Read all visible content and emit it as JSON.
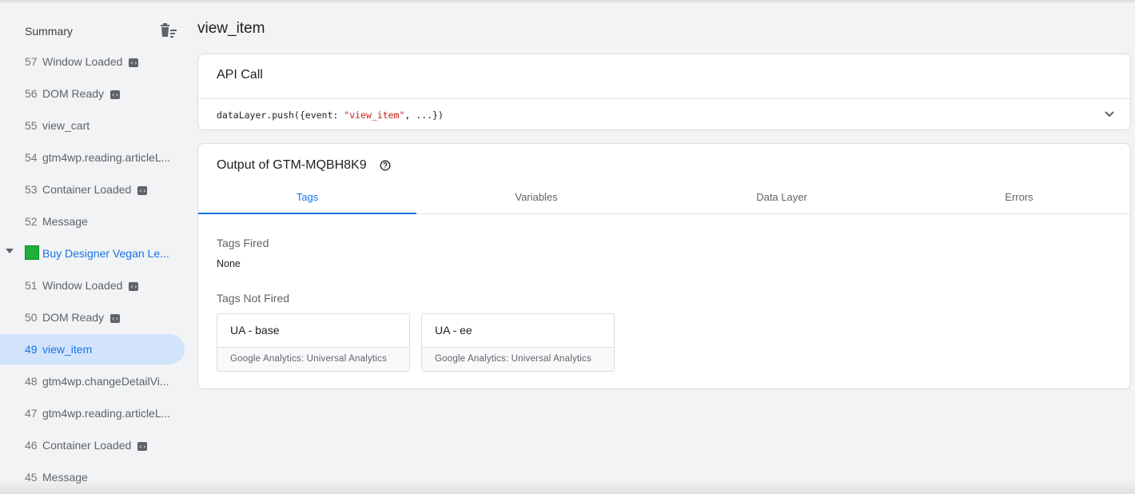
{
  "sidebar": {
    "summary_label": "Summary",
    "events_top": [
      {
        "num": "57",
        "name": "Window Loaded",
        "api": true
      },
      {
        "num": "56",
        "name": "DOM Ready",
        "api": true
      },
      {
        "num": "55",
        "name": "view_cart",
        "api": false
      },
      {
        "num": "54",
        "name": "gtm4wp.reading.articleL...",
        "api": false
      },
      {
        "num": "53",
        "name": "Container Loaded",
        "api": true
      },
      {
        "num": "52",
        "name": "Message",
        "api": false
      }
    ],
    "page_group": {
      "title": "Buy Designer Vegan Le...",
      "swatch_color": "#1db03a",
      "expanded": true
    },
    "events_bottom": [
      {
        "num": "51",
        "name": "Window Loaded",
        "api": true
      },
      {
        "num": "50",
        "name": "DOM Ready",
        "api": true
      },
      {
        "num": "49",
        "name": "view_item",
        "api": false,
        "active": true
      },
      {
        "num": "48",
        "name": "gtm4wp.changeDetailVi...",
        "api": false
      },
      {
        "num": "47",
        "name": "gtm4wp.reading.articleL...",
        "api": false
      },
      {
        "num": "46",
        "name": "Container Loaded",
        "api": true
      },
      {
        "num": "45",
        "name": "Message",
        "api": false
      }
    ]
  },
  "main": {
    "title": "view_item",
    "api_call": {
      "header": "API Call",
      "code_prefix": "dataLayer.push({event: ",
      "code_string": "\"view_item\"",
      "code_suffix": ", ...})"
    },
    "output": {
      "header": "Output of GTM-MQBH8K9",
      "tabs": [
        "Tags",
        "Variables",
        "Data Layer",
        "Errors"
      ],
      "active_tab": "Tags",
      "tags_fired_label": "Tags Fired",
      "tags_fired_value": "None",
      "tags_not_fired_label": "Tags Not Fired",
      "tags_not_fired": [
        {
          "name": "UA - base",
          "type": "Google Analytics: Universal Analytics"
        },
        {
          "name": "UA - ee",
          "type": "Google Analytics: Universal Analytics"
        }
      ]
    }
  },
  "colors": {
    "accent": "#1a73e8",
    "active_bg": "#d2e3fc",
    "string": "#c5221f"
  },
  "icons": {
    "clear": "clear-all-icon",
    "api": "code-icon",
    "expand": "chevron-down-icon",
    "help": "help-icon",
    "caret": "caret-down-icon"
  }
}
